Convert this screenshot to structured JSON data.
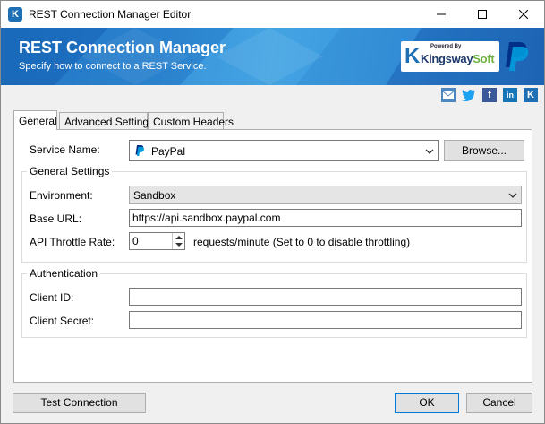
{
  "window": {
    "title": "REST Connection Manager Editor",
    "app_icon": "kingswaysoft-icon",
    "controls": [
      "minimize-icon",
      "maximize-icon",
      "close-icon"
    ]
  },
  "banner": {
    "title": "REST Connection Manager",
    "subtitle": "Specify how to connect to a REST Service.",
    "logo_powered_by": "Powered By",
    "logo_kings": "Kingsway",
    "logo_soft": "Soft",
    "logo_k": "K",
    "service_logo": "paypal-logo",
    "colors": {
      "banner_dark": "#1b6fc0",
      "banner_light": "#3fa0e0",
      "kingsway_blue": "#1f3a6e",
      "soft_green": "#6fb23d"
    }
  },
  "social": {
    "icons": [
      "email-icon",
      "twitter-icon",
      "facebook-icon",
      "linkedin-icon",
      "kingswaysoft-icon"
    ],
    "facebook_glyph": "f",
    "linkedin_glyph": "in",
    "kingsway_glyph": "K"
  },
  "tabs": [
    {
      "label": "General",
      "active": true
    },
    {
      "label": "Advanced Settings",
      "active": false
    },
    {
      "label": "Custom Headers",
      "active": false
    }
  ],
  "general": {
    "service_name_label": "Service Name:",
    "service_name_value": "PayPal",
    "browse_label": "Browse...",
    "general_settings_title": "General Settings",
    "environment_label": "Environment:",
    "environment_value": "Sandbox",
    "base_url_label": "Base URL:",
    "base_url_value": "https://api.sandbox.paypal.com",
    "throttle_label": "API Throttle Rate:",
    "throttle_value": "0",
    "throttle_hint": "requests/minute (Set to 0 to disable throttling)",
    "auth_title": "Authentication",
    "client_id_label": "Client ID:",
    "client_id_value": "",
    "client_secret_label": "Client Secret:",
    "client_secret_value": ""
  },
  "footer": {
    "test_connection": "Test Connection",
    "ok": "OK",
    "cancel": "Cancel"
  }
}
